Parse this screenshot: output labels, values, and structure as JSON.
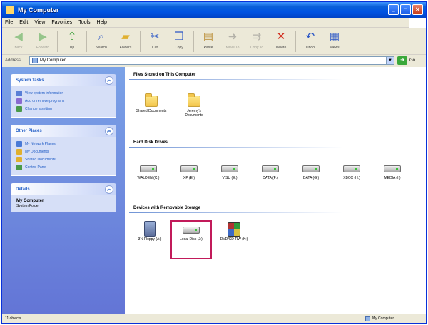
{
  "window": {
    "title": "My Computer"
  },
  "menu": [
    "File",
    "Edit",
    "View",
    "Favorites",
    "Tools",
    "Help"
  ],
  "toolbar": [
    {
      "label": "Back",
      "icon": "back-icon",
      "glyph": "◀",
      "color": "#2f9a2f",
      "disabled": true
    },
    {
      "label": "Forward",
      "icon": "forward-icon",
      "glyph": "▶",
      "color": "#2f9a2f",
      "disabled": true
    },
    {
      "label": "Up",
      "icon": "up-folder-icon",
      "glyph": "⇧",
      "color": "#2f9a2f",
      "disabled": false
    },
    {
      "label": "Search",
      "icon": "search-icon",
      "glyph": "⌕",
      "color": "#2a56c6",
      "disabled": false
    },
    {
      "label": "Folders",
      "icon": "folders-icon",
      "glyph": "▰",
      "color": "#e0b030",
      "disabled": false
    },
    {
      "label": "Cut",
      "icon": "cut-icon",
      "glyph": "✂",
      "color": "#2a56c6",
      "disabled": false
    },
    {
      "label": "Copy",
      "icon": "copy-icon",
      "glyph": "❐",
      "color": "#2a56c6",
      "disabled": false
    },
    {
      "label": "Paste",
      "icon": "paste-icon",
      "glyph": "▤",
      "color": "#b88a30",
      "disabled": false
    },
    {
      "label": "Move To",
      "icon": "move-to-icon",
      "glyph": "➜",
      "color": "#6f6f6f",
      "disabled": true
    },
    {
      "label": "Copy To",
      "icon": "copy-to-icon",
      "glyph": "⇉",
      "color": "#6f6f6f",
      "disabled": true
    },
    {
      "label": "Delete",
      "icon": "delete-icon",
      "glyph": "✕",
      "color": "#d12a1a",
      "disabled": false
    },
    {
      "label": "Undo",
      "icon": "undo-icon",
      "glyph": "↶",
      "color": "#2a56c6",
      "disabled": false
    },
    {
      "label": "Views",
      "icon": "views-icon",
      "glyph": "▦",
      "color": "#2a56c6",
      "disabled": false
    }
  ],
  "address": {
    "label": "Address",
    "value": "My Computer",
    "go": "Go"
  },
  "taskpane": {
    "system_tasks": {
      "title": "System Tasks",
      "items": [
        {
          "label": "View system information",
          "color": "#5a7fd6"
        },
        {
          "label": "Add or remove programs",
          "color": "#8a6ad0"
        },
        {
          "label": "Change a setting",
          "color": "#4a9a4a"
        }
      ]
    },
    "other_places": {
      "title": "Other Places",
      "items": [
        {
          "label": "My Network Places",
          "color": "#4a7ad6"
        },
        {
          "label": "My Documents",
          "color": "#e0b030"
        },
        {
          "label": "Shared Documents",
          "color": "#e0b030"
        },
        {
          "label": "Control Panel",
          "color": "#4a9a4a"
        }
      ]
    },
    "details": {
      "title": "Details",
      "name": "My Computer",
      "sub": "System Folder"
    }
  },
  "groups": {
    "files": {
      "title": "Files Stored on This Computer",
      "items": [
        {
          "name": "shared-documents-folder",
          "label": "Shared Documents"
        },
        {
          "name": "my-documents-folder",
          "label": "Jeremy's Documents"
        }
      ]
    },
    "hdd": {
      "title": "Hard Disk Drives",
      "items": [
        {
          "label": "WALDEN (C:)"
        },
        {
          "label": "XP (E:)"
        },
        {
          "label": "VISU (E:)"
        },
        {
          "label": "DATA (F:)"
        },
        {
          "label": "DATA (G:)"
        },
        {
          "label": "XBOX (H:)"
        },
        {
          "label": "MEDIA (I:)"
        }
      ]
    },
    "removable": {
      "title": "Devices with Removable Storage",
      "items": [
        {
          "name": "floppy-drive",
          "label": "3½ Floppy (A:)",
          "type": "floppy"
        },
        {
          "name": "local-disk-drive",
          "label": "Local Disk (J:)",
          "type": "drive"
        },
        {
          "name": "dvd-drive",
          "label": "DVD/CD-RW (K:)",
          "type": "dvd"
        }
      ]
    }
  },
  "status": {
    "left": "11 objects",
    "right": "My Computer"
  }
}
